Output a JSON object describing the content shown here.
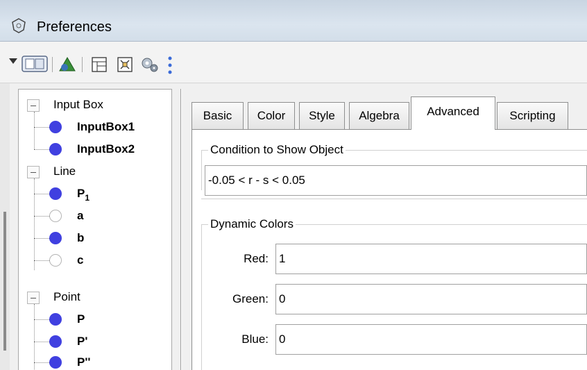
{
  "window": {
    "title": "Preferences"
  },
  "toolbar": {
    "icons": [
      "menu-triangle-icon",
      "graphics-view-icon",
      "geometry-icon",
      "layout-icon",
      "spreadsheet-icon",
      "settings-gear-icon",
      "more-dots-icon"
    ]
  },
  "tree": {
    "groups": [
      {
        "label": "Input Box",
        "items": [
          {
            "label": "InputBox1",
            "sub": "",
            "filled": true
          },
          {
            "label": "InputBox2",
            "sub": "",
            "filled": true
          }
        ]
      },
      {
        "label": "Line",
        "items": [
          {
            "label": "P",
            "sub": "1",
            "filled": true
          },
          {
            "label": "a",
            "sub": "",
            "filled": false
          },
          {
            "label": "b",
            "sub": "",
            "filled": true
          },
          {
            "label": "c",
            "sub": "",
            "filled": false
          }
        ]
      },
      {
        "label": "Point",
        "items": [
          {
            "label": "P",
            "sub": "",
            "filled": true
          },
          {
            "label": "P'",
            "sub": "",
            "filled": true
          },
          {
            "label": "P''",
            "sub": "",
            "filled": true
          }
        ]
      }
    ]
  },
  "tabs": [
    "Basic",
    "Color",
    "Style",
    "Algebra",
    "Advanced",
    "Scripting"
  ],
  "active_tab": "Advanced",
  "condition": {
    "legend": "Condition to Show Object",
    "value": "-0.05 < r - s < 0.05"
  },
  "dynamic_colors": {
    "legend": "Dynamic Colors",
    "red_label": "Red:",
    "red_value": "1",
    "green_label": "Green:",
    "green_value": "0",
    "blue_label": "Blue:",
    "blue_value": "0"
  },
  "colors": {
    "dot_filled": "#4040e0",
    "tab_border": "#8e8f8f",
    "titlebar": "#d3dee9"
  }
}
